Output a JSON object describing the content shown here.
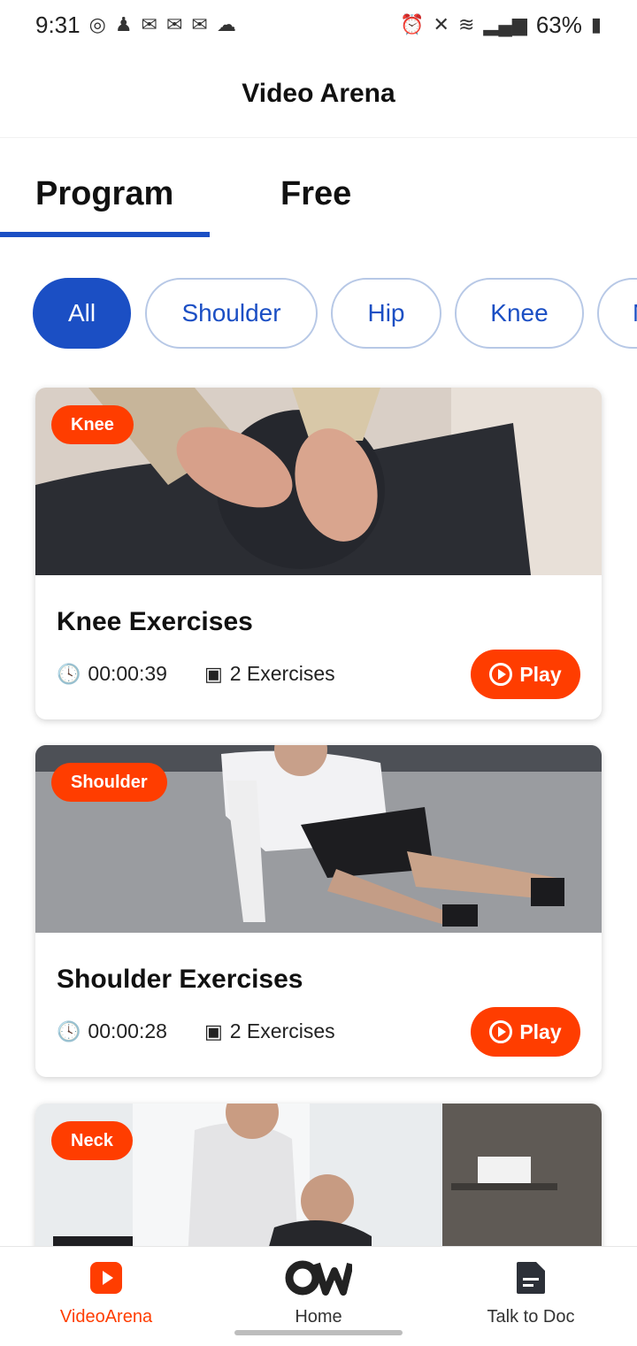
{
  "status_bar": {
    "time": "9:31",
    "left_icons": [
      "whatsapp-icon",
      "person-add-icon",
      "gmail-icon",
      "gmail-icon",
      "gmail-icon",
      "cloud-icon"
    ],
    "right_icons": [
      "alarm-icon",
      "mute-icon",
      "wifi-icon",
      "signal-icon"
    ],
    "battery": "63%"
  },
  "header": {
    "title": "Video Arena"
  },
  "tabs": [
    {
      "label": "Program",
      "active": true
    },
    {
      "label": "Free",
      "active": false
    }
  ],
  "chips": [
    {
      "label": "All",
      "active": true
    },
    {
      "label": "Shoulder",
      "active": false
    },
    {
      "label": "Hip",
      "active": false
    },
    {
      "label": "Knee",
      "active": false
    },
    {
      "label": "N",
      "active": false
    }
  ],
  "cards": [
    {
      "badge": "Knee",
      "title": "Knee Exercises",
      "duration": "00:00:39",
      "exercises": "2 Exercises",
      "play_label": "Play"
    },
    {
      "badge": "Shoulder",
      "title": "Shoulder Exercises",
      "duration": "00:00:28",
      "exercises": "2 Exercises",
      "play_label": "Play"
    },
    {
      "badge": "Neck"
    }
  ],
  "bottom_nav": [
    {
      "label": "VideoArena",
      "icon": "play-icon",
      "active": true
    },
    {
      "label": "Home",
      "icon": "logo-icon",
      "active": false
    },
    {
      "label": "Talk to Doc",
      "icon": "document-icon",
      "active": false
    }
  ],
  "colors": {
    "accent": "#ff3d00",
    "primary": "#1b4fc4"
  }
}
